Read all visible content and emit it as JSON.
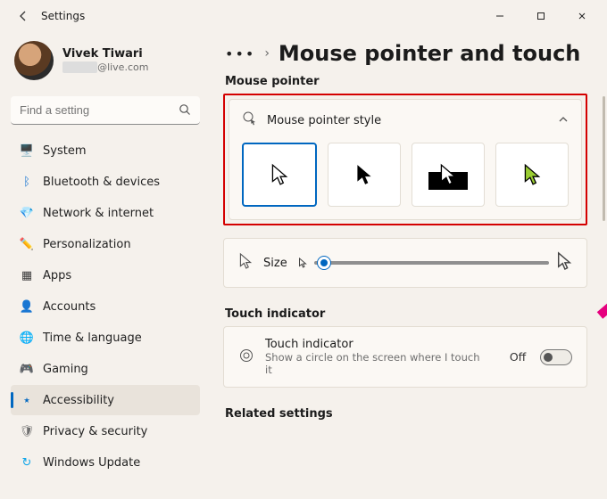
{
  "app": {
    "title": "Settings"
  },
  "window_controls": {
    "minimize": "minimize",
    "maximize": "maximize",
    "close": "close"
  },
  "user": {
    "name": "Vivek Tiwari",
    "email_suffix": "@live.com"
  },
  "search": {
    "placeholder": "Find a setting"
  },
  "nav": {
    "items": [
      {
        "icon": "🖥️",
        "label": "System",
        "color": "#1976d2"
      },
      {
        "icon": "ᛒ",
        "label": "Bluetooth & devices",
        "color": "#1976d2"
      },
      {
        "icon": "💎",
        "label": "Network & internet",
        "color": "#009688"
      },
      {
        "icon": "✏️",
        "label": "Personalization",
        "color": "#c77b1a"
      },
      {
        "icon": "▦",
        "label": "Apps",
        "color": "#3b3b3b"
      },
      {
        "icon": "👤",
        "label": "Accounts",
        "color": "#15803d"
      },
      {
        "icon": "🌐",
        "label": "Time & language",
        "color": "#0ea5e9"
      },
      {
        "icon": "🎮",
        "label": "Gaming",
        "color": "#6e6e6e"
      },
      {
        "icon": "⭑",
        "label": "Accessibility",
        "color": "#0067c0",
        "active": true
      },
      {
        "icon": "🛡",
        "label": "Privacy & security",
        "color": "#6e6e6e"
      },
      {
        "icon": "↻",
        "label": "Windows Update",
        "color": "#0ea5e9"
      }
    ]
  },
  "breadcrumb": {
    "ellipsis": "•••",
    "sep": "›",
    "title": "Mouse pointer and touch"
  },
  "sections": {
    "mouse_pointer": "Mouse pointer",
    "touch_indicator": "Touch indicator",
    "related": "Related settings"
  },
  "pointer_style": {
    "label": "Mouse pointer style",
    "options": [
      "white",
      "black",
      "inverted",
      "custom-green"
    ]
  },
  "size_row": {
    "label": "Size"
  },
  "touch_row": {
    "title": "Touch indicator",
    "subtitle": "Show a circle on the screen where I touch it",
    "state": "Off"
  },
  "annotation": {
    "arrow_target": "custom-color-tile"
  }
}
